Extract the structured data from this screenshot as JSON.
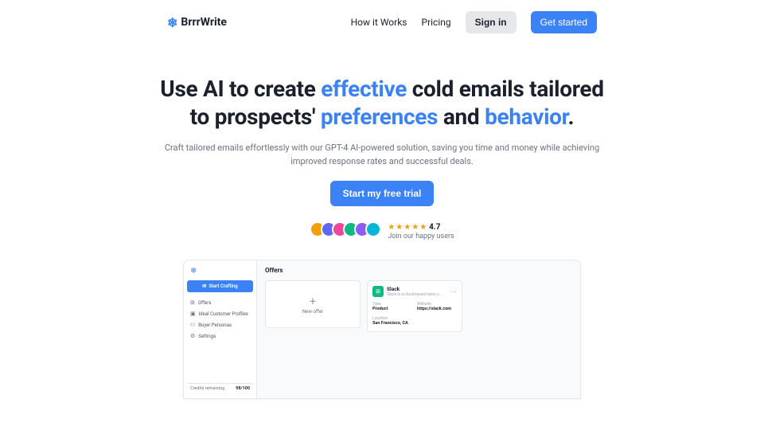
{
  "brand": "BrrrWrite",
  "nav": {
    "how": "How it Works",
    "pricing": "Pricing",
    "signin": "Sign in",
    "getstarted": "Get started"
  },
  "hero": {
    "pre1": "Use AI to create ",
    "hl1": "effective",
    "post1": " cold emails tailored to prospects' ",
    "hl2": "preferences",
    "mid": " and ",
    "hl3": "behavior",
    "end": ".",
    "subtitle": "Craft tailored emails effortlessly with our GPT-4 AI-powered solution, saving you time and money while achieving improved response rates and successful deals.",
    "cta": "Start my free trial"
  },
  "social": {
    "stars": "★★★★★",
    "score": "4.7",
    "join": "Join our happy users"
  },
  "avatarColors": [
    "#f59e0b",
    "#6366f1",
    "#ec4899",
    "#10b981",
    "#8b5cf6",
    "#06b6d4"
  ],
  "dashboard": {
    "start": "Start Crafting",
    "menu": {
      "offers": "Offers",
      "icp": "Ideal Customer Profiles",
      "personas": "Buyer Personas",
      "settings": "Settings"
    },
    "creditsLabel": "Credits remaining",
    "creditsValue": "98/100",
    "title": "Offers",
    "newOffer": "New offer",
    "slack": {
      "name": "Slack",
      "desc": "Slack is a cloud-based team c...",
      "typeLabel": "Type",
      "typeValue": "Product",
      "websiteLabel": "Website",
      "websiteValue": "https://slack.com",
      "locationLabel": "Location",
      "locationValue": "San Francisco, CA"
    }
  }
}
